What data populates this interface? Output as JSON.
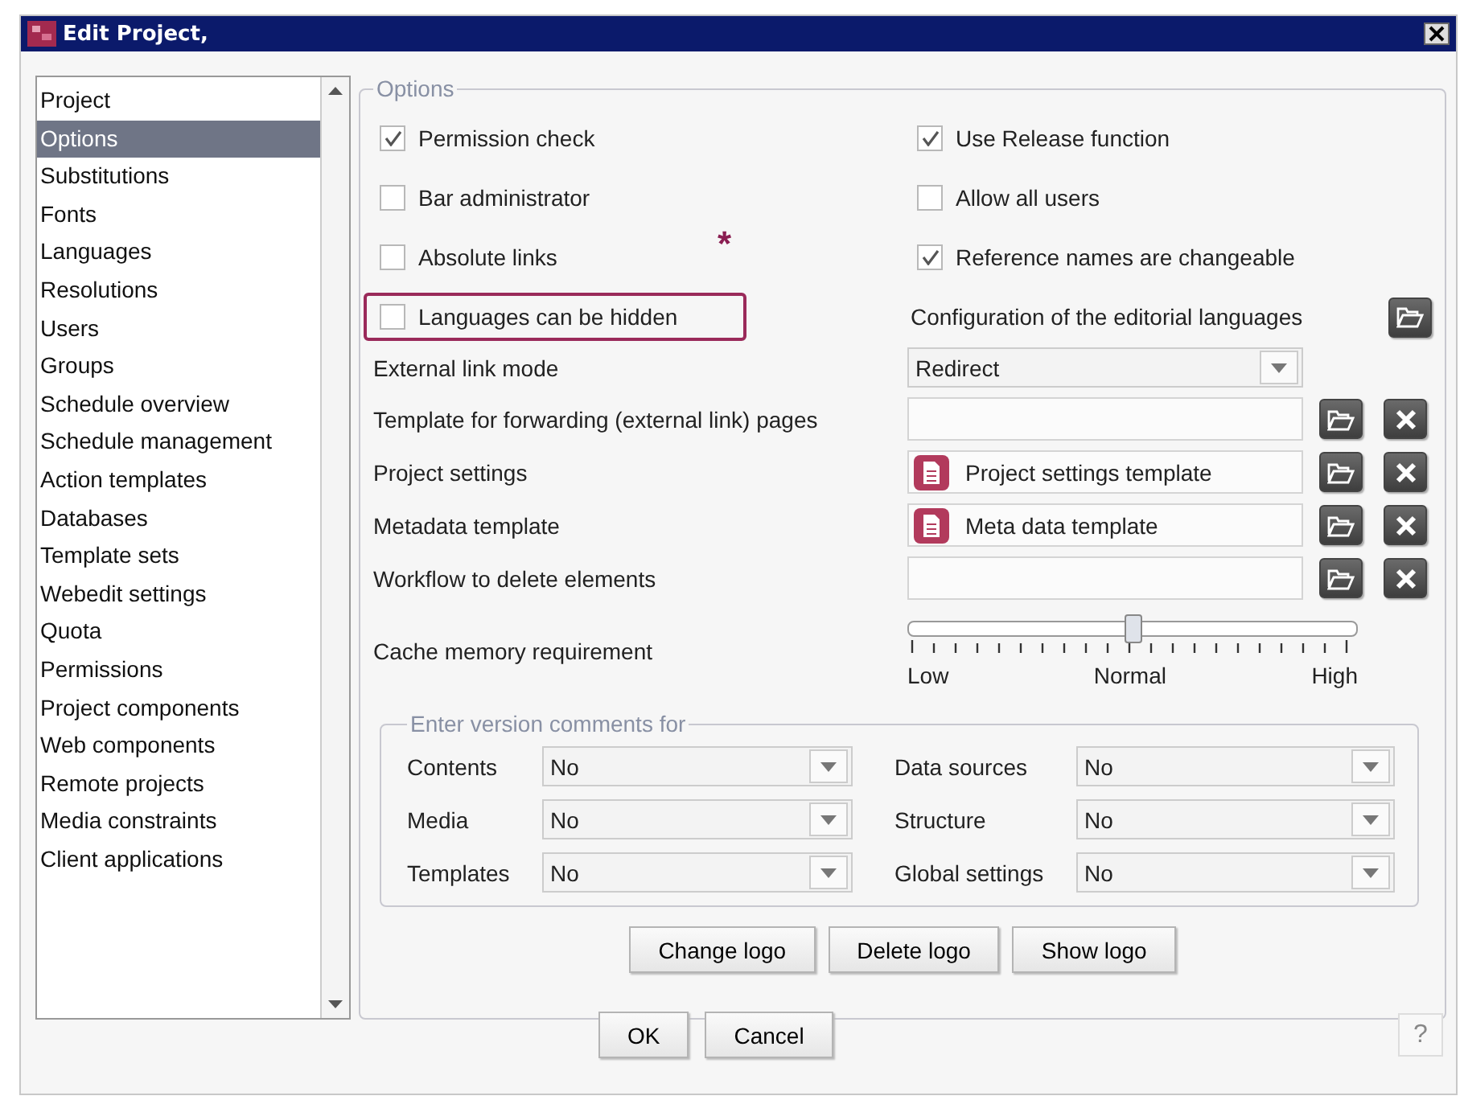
{
  "window": {
    "title": "Edit Project,"
  },
  "sidebar": {
    "items": [
      {
        "label": "Project",
        "selected": false
      },
      {
        "label": "Options",
        "selected": true
      },
      {
        "label": "Substitutions",
        "selected": false
      },
      {
        "label": "Fonts",
        "selected": false
      },
      {
        "label": "Languages",
        "selected": false
      },
      {
        "label": "Resolutions",
        "selected": false
      },
      {
        "label": "Users",
        "selected": false
      },
      {
        "label": "Groups",
        "selected": false
      },
      {
        "label": "Schedule overview",
        "selected": false
      },
      {
        "label": "Schedule management",
        "selected": false
      },
      {
        "label": "Action templates",
        "selected": false
      },
      {
        "label": "Databases",
        "selected": false
      },
      {
        "label": "Template sets",
        "selected": false
      },
      {
        "label": "Webedit settings",
        "selected": false
      },
      {
        "label": "Quota",
        "selected": false
      },
      {
        "label": "Permissions",
        "selected": false
      },
      {
        "label": "Project components",
        "selected": false
      },
      {
        "label": "Web components",
        "selected": false
      },
      {
        "label": "Remote projects",
        "selected": false
      },
      {
        "label": "Media constraints",
        "selected": false
      },
      {
        "label": "Client applications",
        "selected": false
      }
    ]
  },
  "options": {
    "legend": "Options",
    "checkboxes": [
      {
        "label": "Permission check",
        "checked": true,
        "highlighted": false
      },
      {
        "label": "Use Release function",
        "checked": true,
        "highlighted": false
      },
      {
        "label": "Bar administrator",
        "checked": false,
        "highlighted": false
      },
      {
        "label": "Allow all users",
        "checked": false,
        "highlighted": false
      },
      {
        "label": "Absolute links",
        "checked": false,
        "highlighted": false,
        "marker": "*"
      },
      {
        "label": "Reference names are changeable",
        "checked": true,
        "highlighted": false
      },
      {
        "label": "Languages can be hidden",
        "checked": false,
        "highlighted": true
      }
    ],
    "language_config": {
      "label": "Configuration of the editorial languages"
    },
    "fields": [
      {
        "kind": "select",
        "label": "External link mode",
        "value": "Redirect"
      },
      {
        "kind": "reference",
        "label": "Template for forwarding (external link) pages"
      },
      {
        "kind": "reference",
        "label": "Project settings",
        "value": "Project settings template"
      },
      {
        "kind": "reference",
        "label": "Metadata template",
        "value": "Meta data template"
      },
      {
        "kind": "reference",
        "label": "Workflow to delete elements"
      }
    ],
    "cache": {
      "label": "Cache memory requirement",
      "level": 0.5,
      "scale": [
        "Low",
        "Normal",
        "High"
      ]
    },
    "version_comments": {
      "legend": "Enter version comments for",
      "fields": [
        {
          "label": "Contents",
          "value": "No"
        },
        {
          "label": "Data sources",
          "value": "No"
        },
        {
          "label": "Media",
          "value": "No"
        },
        {
          "label": "Structure",
          "value": "No"
        },
        {
          "label": "Templates",
          "value": "No"
        },
        {
          "label": "Global settings",
          "value": "No"
        }
      ]
    },
    "logo_buttons": [
      "Change logo",
      "Delete logo",
      "Show logo"
    ]
  },
  "buttons": [
    "OK",
    "Cancel"
  ],
  "help": "?"
}
